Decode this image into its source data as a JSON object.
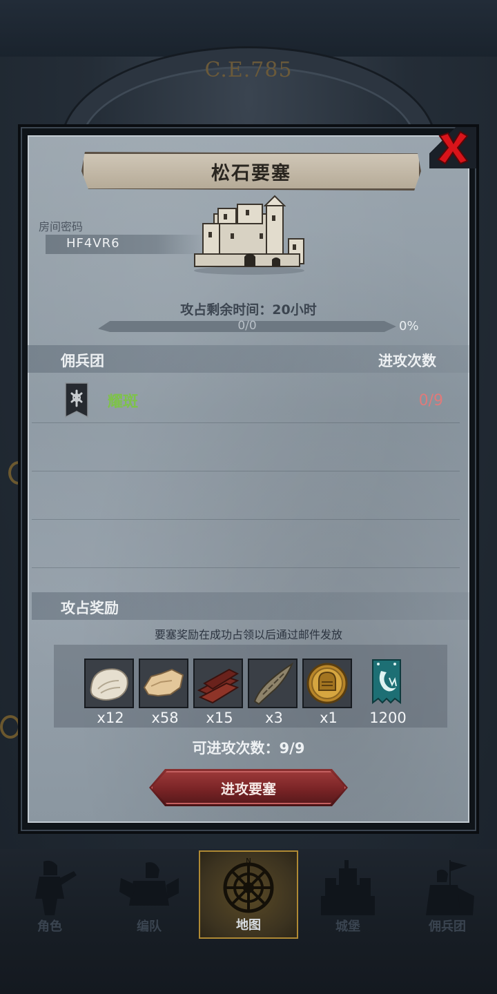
{
  "background": {
    "era_label": "C.E.785"
  },
  "dialog": {
    "title": "松石要塞",
    "room_password_label": "房间密码",
    "room_password": "HF4VR6",
    "timer": "攻占剩余时间：20小时",
    "progress": {
      "count": "0/0",
      "percent": "0%",
      "fraction": 0
    },
    "mercenary_header": "佣兵团",
    "attack_count_header": "进攻次数",
    "mercenaries": [
      {
        "name": "耀斑",
        "attacks": "0/9"
      }
    ],
    "rewards_header": "攻占奖励",
    "rewards_note": "要塞奖励在成功占领以后通过邮件发放",
    "rewards": [
      {
        "icon": "fur-pelt-icon",
        "count": "x12"
      },
      {
        "icon": "leather-hide-icon",
        "count": "x58"
      },
      {
        "icon": "wood-logs-icon",
        "count": "x15"
      },
      {
        "icon": "horn-icon",
        "count": "x3"
      },
      {
        "icon": "knight-helmet-coin-icon",
        "count": "x1"
      },
      {
        "icon": "guild-banner-icon",
        "count": "1200"
      }
    ],
    "attacks_available": "可进攻次数：9/9",
    "attack_button": "进攻要塞"
  },
  "nav": {
    "tabs": [
      {
        "label": "角色",
        "icon": "knight-icon",
        "active": false
      },
      {
        "label": "编队",
        "icon": "formation-icon",
        "active": false
      },
      {
        "label": "地图",
        "icon": "compass-icon",
        "active": true
      },
      {
        "label": "城堡",
        "icon": "castle-icon",
        "active": false
      },
      {
        "label": "佣兵团",
        "icon": "mercenary-icon",
        "active": false
      }
    ]
  },
  "colors": {
    "accent_gold": "#b08a34",
    "mercenary_green": "#7ec24a",
    "attacks_red": "#e07a7a",
    "button_red": "#7a2426"
  }
}
